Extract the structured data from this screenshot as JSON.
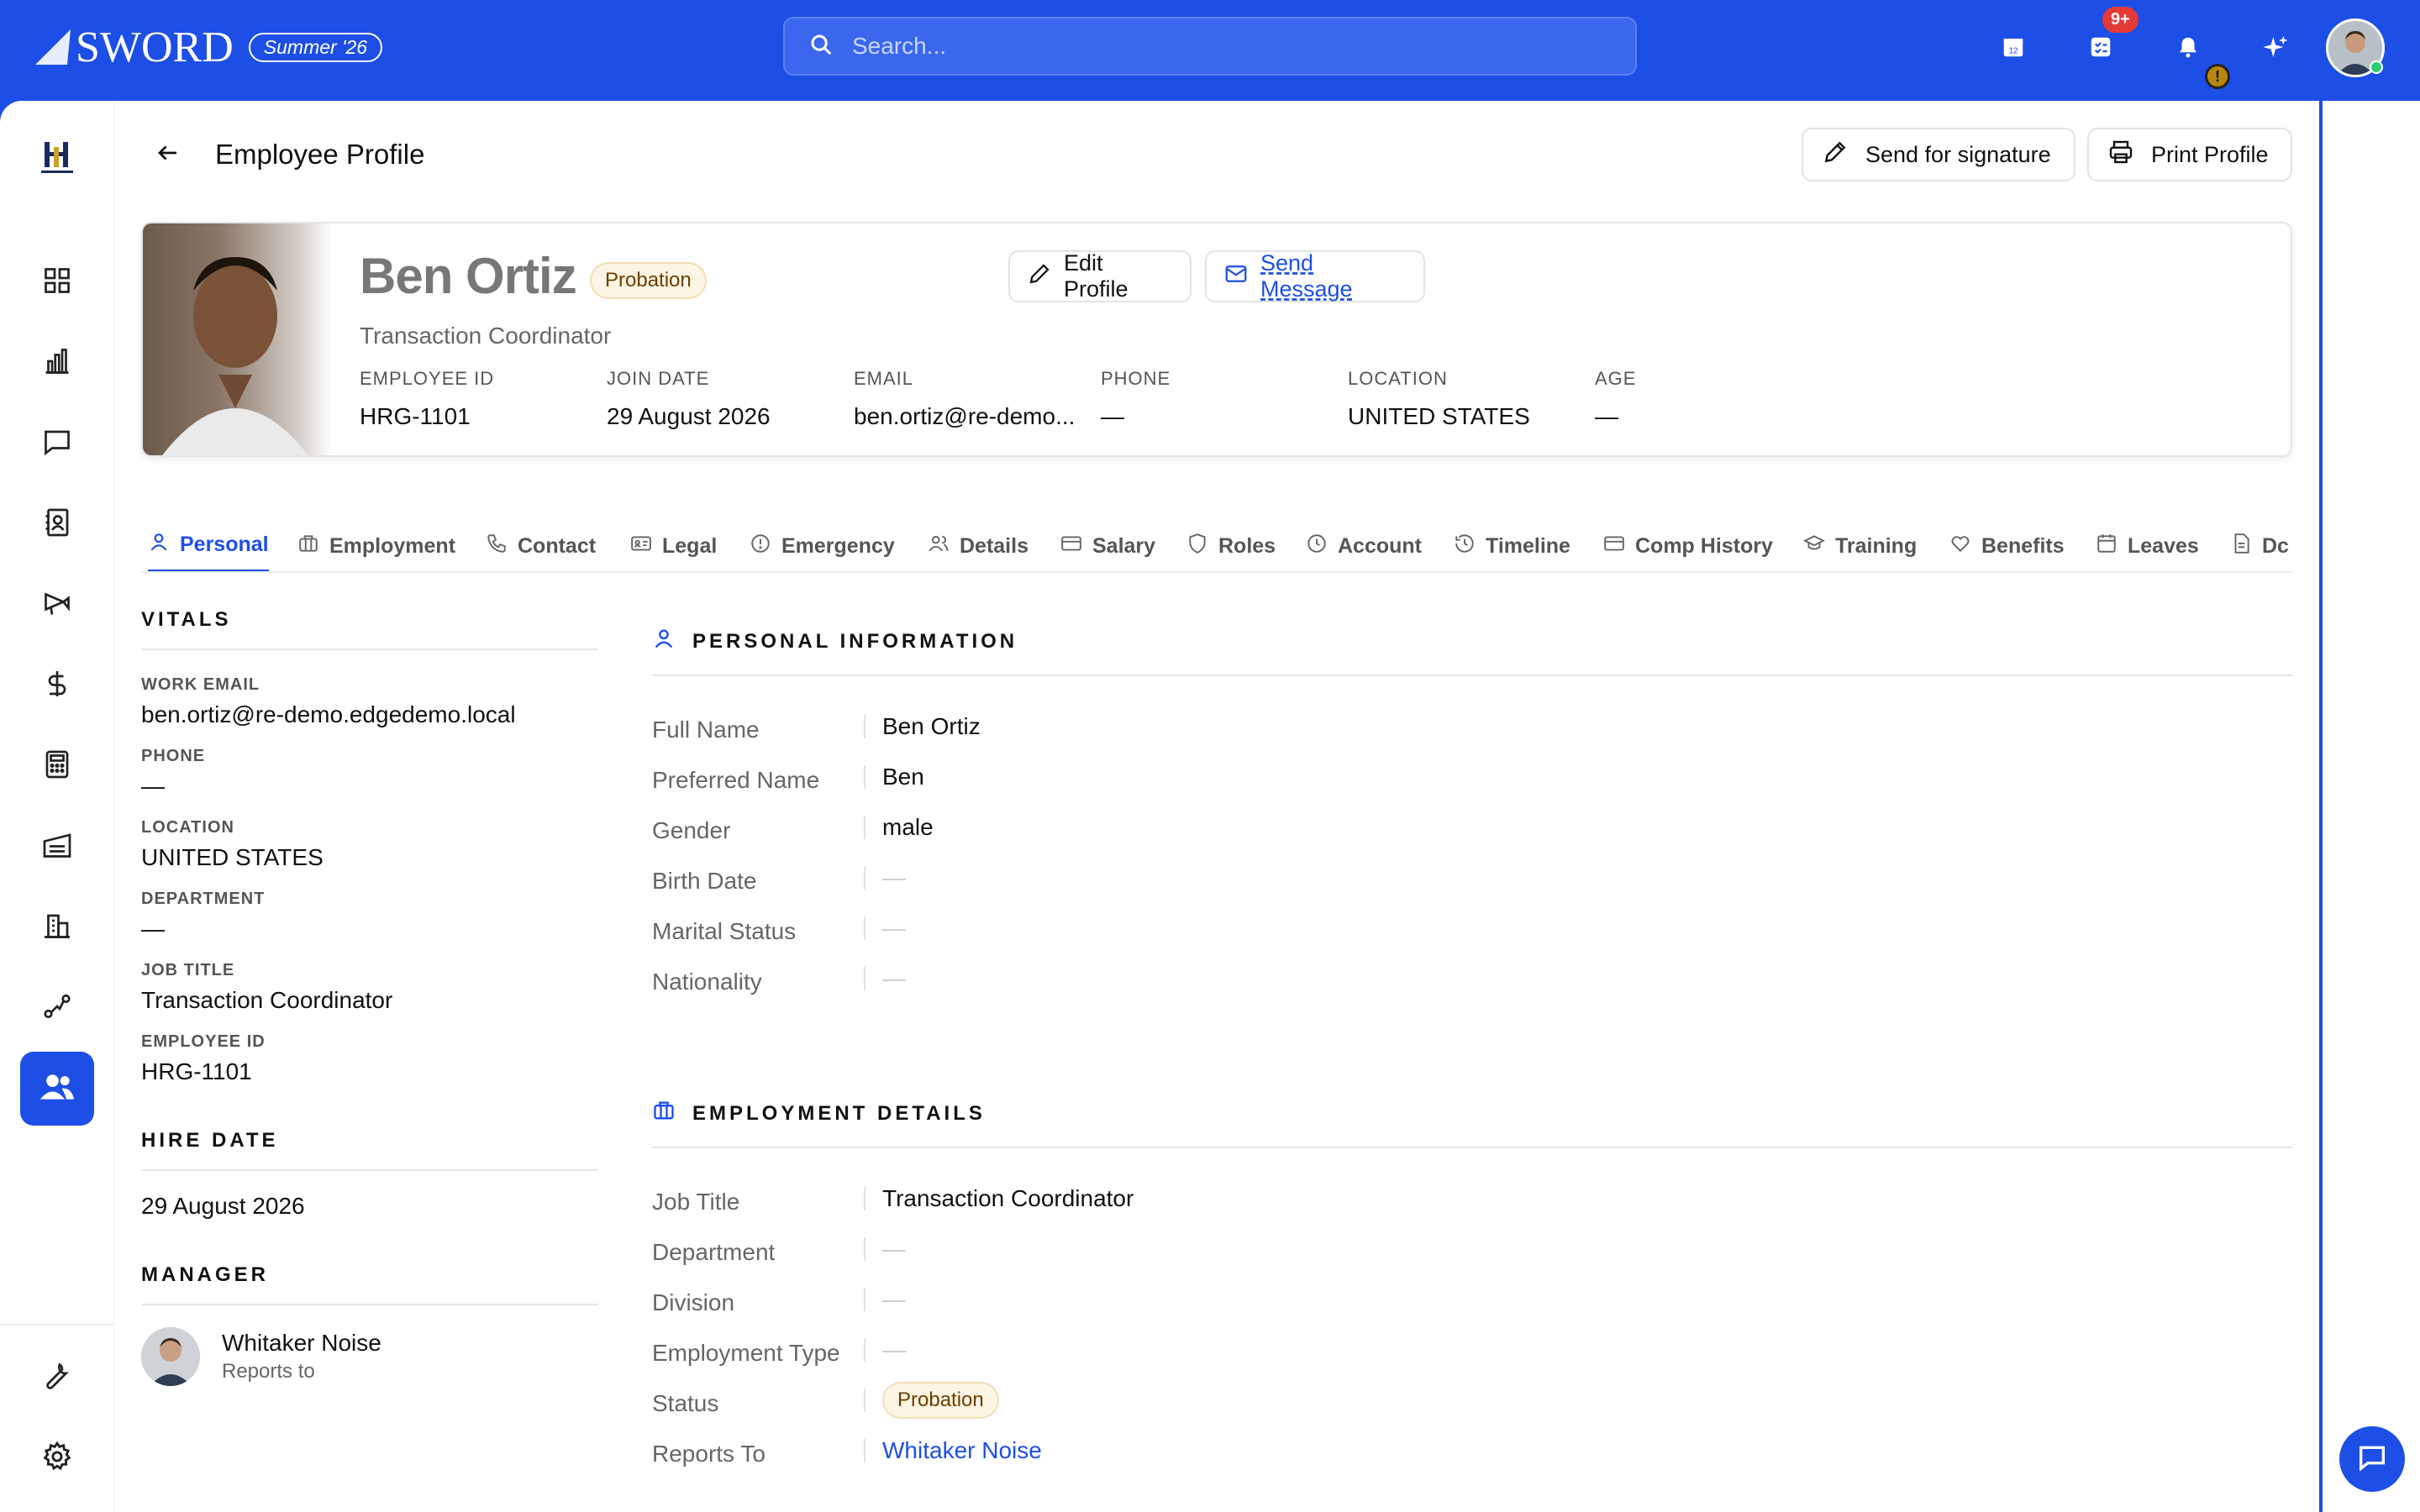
{
  "app": {
    "brand": "SWORD",
    "release_badge": "Summer '26",
    "search_placeholder": "Search...",
    "tasks_badge": "9+",
    "alert_badge": "!"
  },
  "page": {
    "title": "Employee Profile",
    "send_signature_label": "Send for signature",
    "print_profile_label": "Print Profile"
  },
  "profile": {
    "name": "Ben Ortiz",
    "status": "Probation",
    "role": "Transaction Coordinator",
    "edit_label": "Edit Profile",
    "message_label": "Send Message",
    "facts": [
      {
        "label": "EMPLOYEE ID",
        "value": "HRG-1101"
      },
      {
        "label": "JOIN DATE",
        "value": "29 August 2026"
      },
      {
        "label": "EMAIL",
        "value": "ben.ortiz@re-demo..."
      },
      {
        "label": "PHONE",
        "value": "—"
      },
      {
        "label": "LOCATION",
        "value": "UNITED STATES"
      },
      {
        "label": "AGE",
        "value": "—"
      }
    ]
  },
  "tabs": [
    {
      "label": "Personal",
      "icon": "user-icon"
    },
    {
      "label": "Employment",
      "icon": "briefcase-icon"
    },
    {
      "label": "Contact",
      "icon": "phone-icon"
    },
    {
      "label": "Legal",
      "icon": "id-card-icon"
    },
    {
      "label": "Emergency",
      "icon": "alert-circle-icon"
    },
    {
      "label": "Details",
      "icon": "users-icon"
    },
    {
      "label": "Salary",
      "icon": "credit-card-icon"
    },
    {
      "label": "Roles",
      "icon": "shield-icon"
    },
    {
      "label": "Account",
      "icon": "clock-icon"
    },
    {
      "label": "Timeline",
      "icon": "history-icon"
    },
    {
      "label": "Comp History",
      "icon": "credit-card-icon"
    },
    {
      "label": "Training",
      "icon": "graduation-cap-icon"
    },
    {
      "label": "Benefits",
      "icon": "heart-icon"
    },
    {
      "label": "Leaves",
      "icon": "calendar-icon"
    },
    {
      "label": "Dc",
      "icon": "document-icon"
    }
  ],
  "vitals": {
    "heading": "VITALS",
    "items": [
      {
        "label": "WORK EMAIL",
        "value": "ben.ortiz@re-demo.edgedemo.local"
      },
      {
        "label": "PHONE",
        "value": "—"
      },
      {
        "label": "LOCATION",
        "value": "UNITED STATES"
      },
      {
        "label": "DEPARTMENT",
        "value": "—"
      },
      {
        "label": "JOB TITLE",
        "value": "Transaction Coordinator"
      },
      {
        "label": "EMPLOYEE ID",
        "value": "HRG-1101"
      }
    ]
  },
  "hire_date": {
    "heading": "HIRE DATE",
    "value": "29 August 2026"
  },
  "manager": {
    "heading": "MANAGER",
    "name": "Whitaker Noise",
    "sub": "Reports to"
  },
  "personal_info": {
    "heading": "PERSONAL INFORMATION",
    "rows": [
      {
        "label": "Full Name",
        "value": "Ben Ortiz"
      },
      {
        "label": "Preferred Name",
        "value": "Ben"
      },
      {
        "label": "Gender",
        "value": "male"
      },
      {
        "label": "Birth Date",
        "value": "—"
      },
      {
        "label": "Marital Status",
        "value": "—"
      },
      {
        "label": "Nationality",
        "value": "—"
      }
    ]
  },
  "employment_details": {
    "heading": "EMPLOYMENT DETAILS",
    "rows": [
      {
        "label": "Job Title",
        "value": "Transaction Coordinator"
      },
      {
        "label": "Department",
        "value": "—"
      },
      {
        "label": "Division",
        "value": "—"
      },
      {
        "label": "Employment Type",
        "value": "—"
      },
      {
        "label": "Status",
        "value": "Probation"
      },
      {
        "label": "Reports To",
        "value": "Whitaker Noise"
      }
    ]
  },
  "colors": {
    "brand_blue": "#1d4ee6",
    "probation_bg": "#fdf5e4",
    "probation_text": "#6b3d00"
  }
}
